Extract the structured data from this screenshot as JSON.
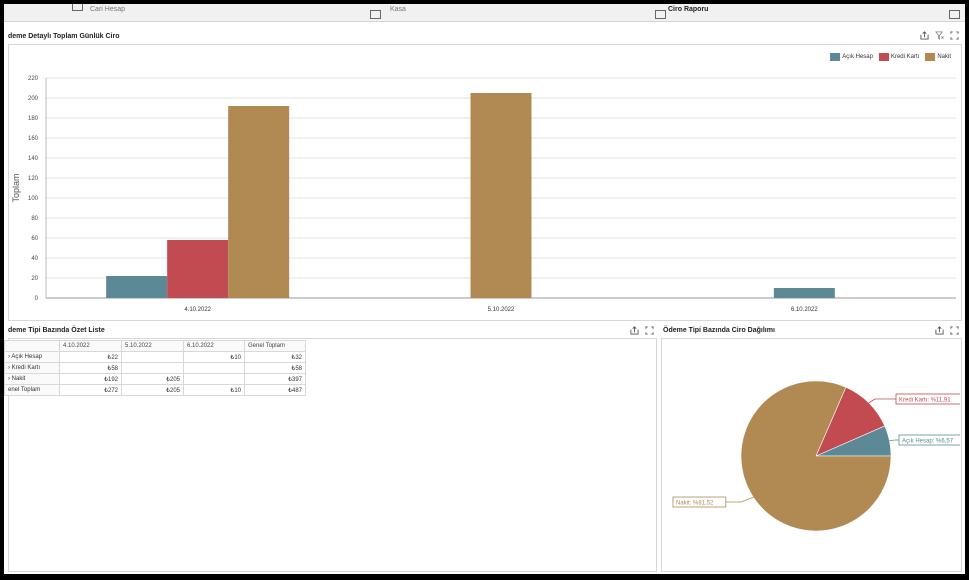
{
  "top_bar": {
    "cells": [
      {
        "label": "Cari Hesap"
      },
      {
        "label": "Kasa"
      },
      {
        "label": "Ciro Raporu"
      }
    ]
  },
  "bar_panel": {
    "title": "deme Detaylı Toplam Günlük Ciro",
    "legend": [
      {
        "label": "Açık Hesap",
        "color": "#5c8995"
      },
      {
        "label": "Kredi Kartı",
        "color": "#c24b51"
      },
      {
        "label": "Nakit",
        "color": "#b08a52"
      }
    ]
  },
  "summary_panel": {
    "title": "deme Tipi Bazında Özet Liste",
    "columns": [
      "",
      "4.10.2022",
      "5.10.2022",
      "6.10.2022",
      "Genel Toplam"
    ],
    "rows": [
      {
        "label": "Açık Hesap",
        "cells": [
          "₺22",
          "",
          "₺10",
          "₺32"
        ]
      },
      {
        "label": "Kredi Kartı",
        "cells": [
          "₺58",
          "",
          "",
          "₺58"
        ]
      },
      {
        "label": "Nakit",
        "cells": [
          "₺192",
          "₺205",
          "",
          "₺397"
        ]
      },
      {
        "label": "enel Toplam",
        "cells": [
          "₺272",
          "₺205",
          "₺10",
          "₺487"
        ]
      }
    ]
  },
  "pie_panel": {
    "title": "Ödeme Tipi Bazında Ciro Dağılımı"
  },
  "chart_data": [
    {
      "type": "bar",
      "title": "deme Detaylı Toplam Günlük Ciro",
      "categories": [
        "4.10.2022",
        "5.10.2022",
        "6.10.2022"
      ],
      "series": [
        {
          "name": "Açık Hesap",
          "color": "#5c8995",
          "values": [
            22,
            null,
            10
          ]
        },
        {
          "name": "Kredi Kartı",
          "color": "#c24b51",
          "values": [
            58,
            null,
            null
          ]
        },
        {
          "name": "Nakit",
          "color": "#b08a52",
          "values": [
            192,
            205,
            null
          ]
        }
      ],
      "ylabel": "Toplam",
      "ylim": [
        0,
        220
      ],
      "yticks": [
        0,
        20,
        40,
        60,
        80,
        100,
        120,
        140,
        160,
        180,
        200,
        220
      ],
      "grid": true,
      "legend": "top-right"
    },
    {
      "type": "pie",
      "title": "Ödeme Tipi Bazında Ciro Dağılımı",
      "slices": [
        {
          "name": "Açık Hesap",
          "value": 6.57,
          "label": "Açık Hesap: %6,57",
          "color": "#5c8995"
        },
        {
          "name": "Kredi Kartı",
          "value": 11.91,
          "label": "Kredi Kartı: %11,91",
          "color": "#c24b51"
        },
        {
          "name": "Nakit",
          "value": 81.52,
          "label": "Nakit: %81,52",
          "color": "#b08a52"
        }
      ]
    }
  ]
}
